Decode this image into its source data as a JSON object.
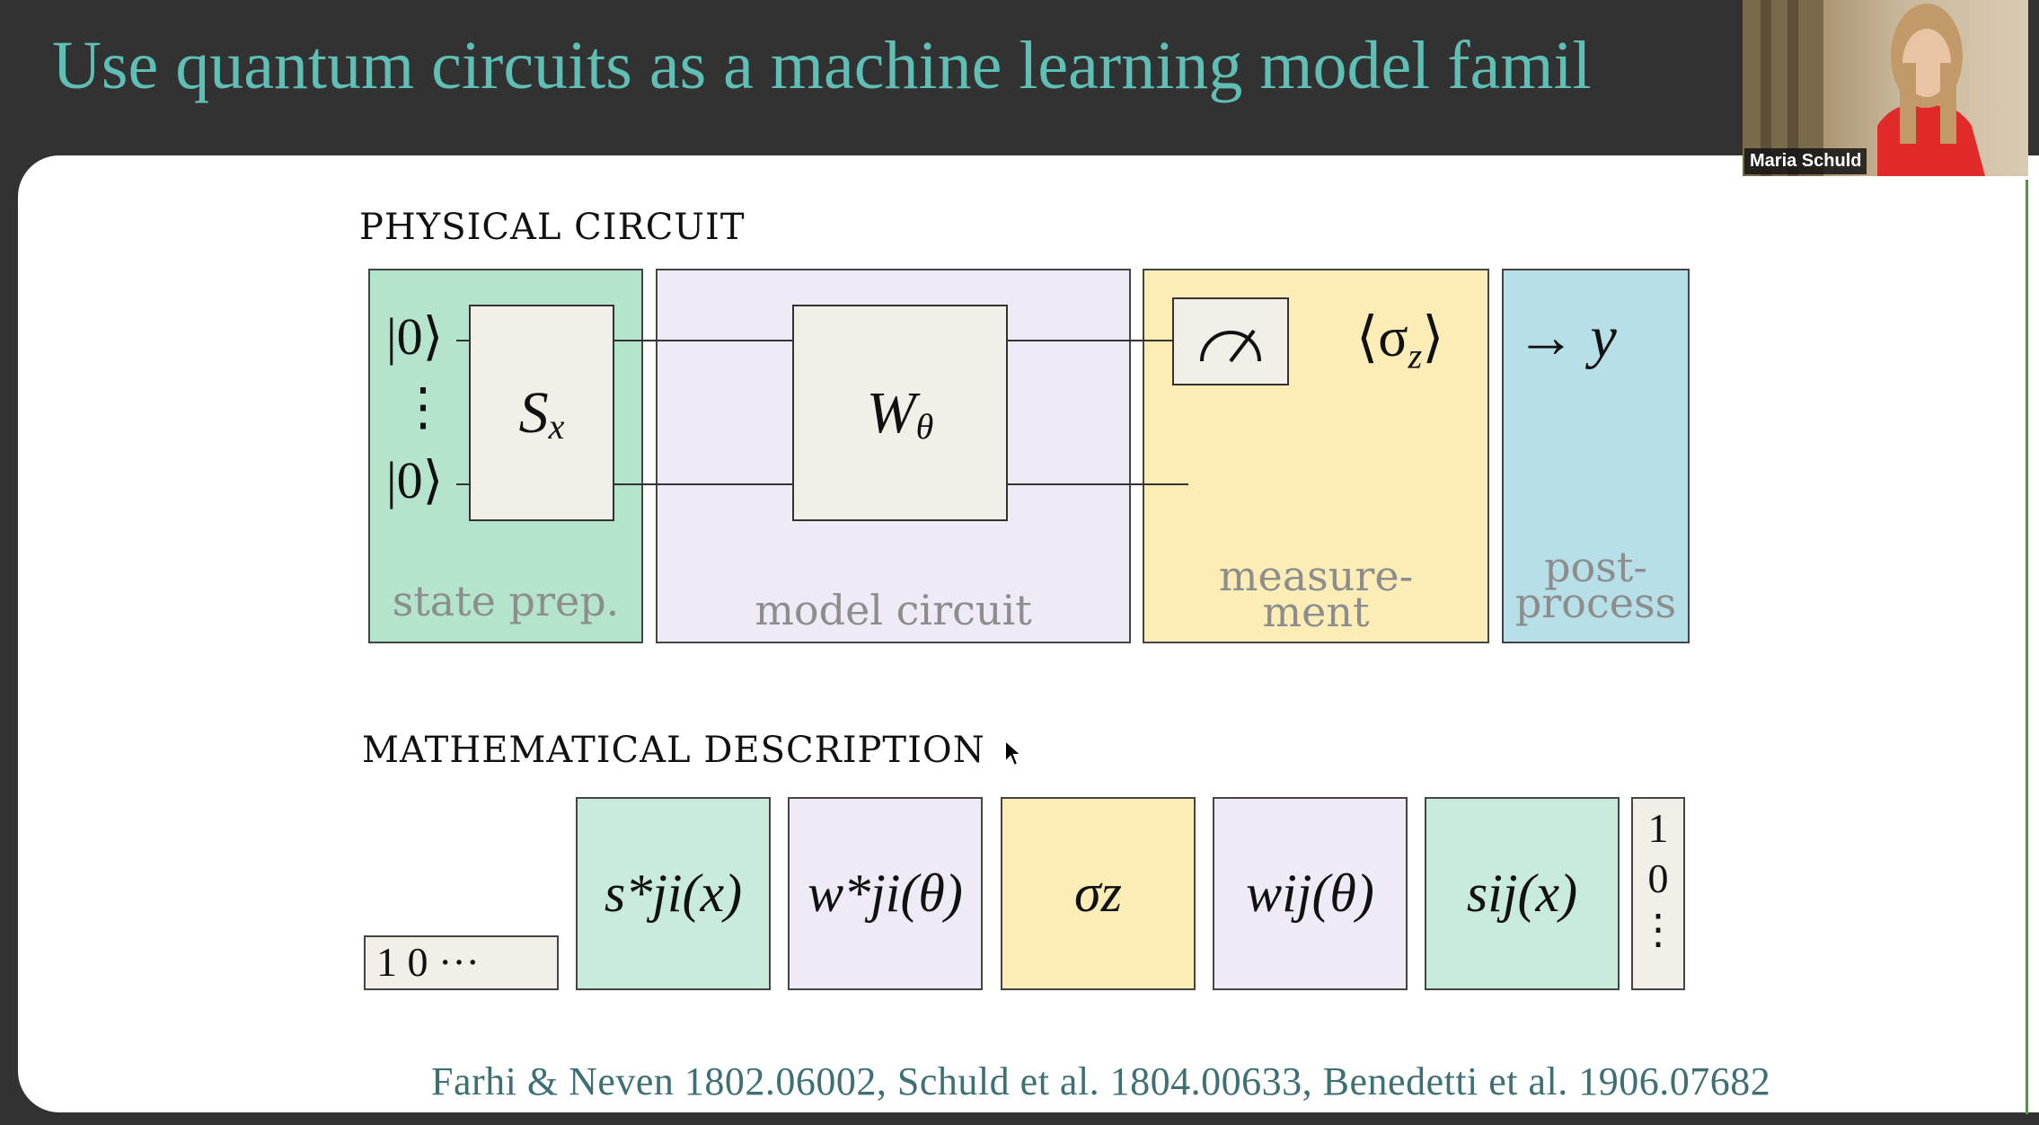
{
  "slide": {
    "title": "Use quantum circuits as a machine learning model famil",
    "physical_label": "PHYSICAL CIRCUIT",
    "math_label": "MATHEMATICAL DESCRIPTION",
    "citation": "Farhi & Neven 1802.06002, Schuld et al.  1804.00633, Benedetti et al.  1906.07682"
  },
  "circuit": {
    "ket_top": "|0⟩",
    "ket_bottom": "|0⟩",
    "vdots": "⋮",
    "gate_s": "S",
    "gate_s_sub": "x",
    "gate_w": "W",
    "gate_w_sub": "θ",
    "expectation": "⟨σ",
    "expectation_sub": "z",
    "expectation_close": "⟩",
    "arrow_y": "→ y",
    "stages": {
      "state_prep": "state prep.",
      "model_circuit": "model circuit",
      "measurement_1": "measure-",
      "measurement_2": "ment",
      "postprocess_1": "post-",
      "postprocess_2": "process"
    }
  },
  "math": {
    "row_vector": "1 0  ···",
    "tiles": [
      "s*ji(x)",
      "w*ji(θ)",
      "σz",
      "wij(θ)",
      "sij(x)"
    ],
    "col_vector": [
      "1",
      "0",
      "⋮"
    ]
  },
  "webcam": {
    "name": "Maria Schuld"
  },
  "colors": {
    "title": "#5fbfb5",
    "green": "#b5e4cc",
    "green_light": "#c9ebdb",
    "purple": "#eeeaf6",
    "yellow": "#fcecb5",
    "blue": "#b7dfe8",
    "gate": "#f2efe8"
  }
}
